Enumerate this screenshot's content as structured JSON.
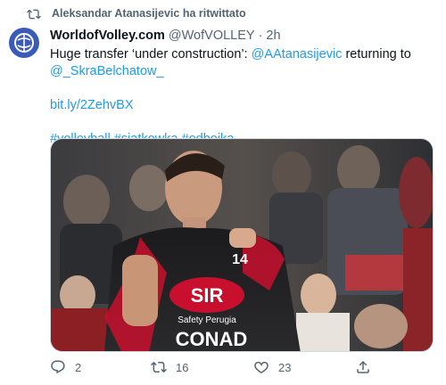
{
  "retweet": {
    "icon": "retweet-icon",
    "text": "Aleksandar Atanasijevic ha ritwittato"
  },
  "tweet": {
    "author_name": "WorldofVolley.com",
    "author_handle": "@WofVOLLEY",
    "separator": "·",
    "time": "2h",
    "text_part1": "Huge transfer ‘under construction’: ",
    "mention1": "@AAtanasijevic",
    "text_part2": " returning to",
    "mention2": "@_SkraBelchatow_",
    "url": "bit.ly/2ZehvBX",
    "hashtag1": "#volleyball",
    "hashtag2": "#siatkowka",
    "hashtag3": "#odbojka",
    "jersey_sponsor": "SIR",
    "jersey_sub": "Safety Perugia",
    "jersey_brand": "CONAD",
    "jersey_number": "14"
  },
  "actions": {
    "reply_count": "2",
    "retweet_count": "16",
    "like_count": "23",
    "reply_icon": "reply-icon",
    "retweet_icon": "retweet-icon",
    "like_icon": "heart-icon",
    "share_icon": "share-icon"
  },
  "colors": {
    "link": "#1d9bf0",
    "secondary_text": "#536471",
    "jersey_red": "#c8102e",
    "avatar_bg": "#3a5bb8"
  }
}
